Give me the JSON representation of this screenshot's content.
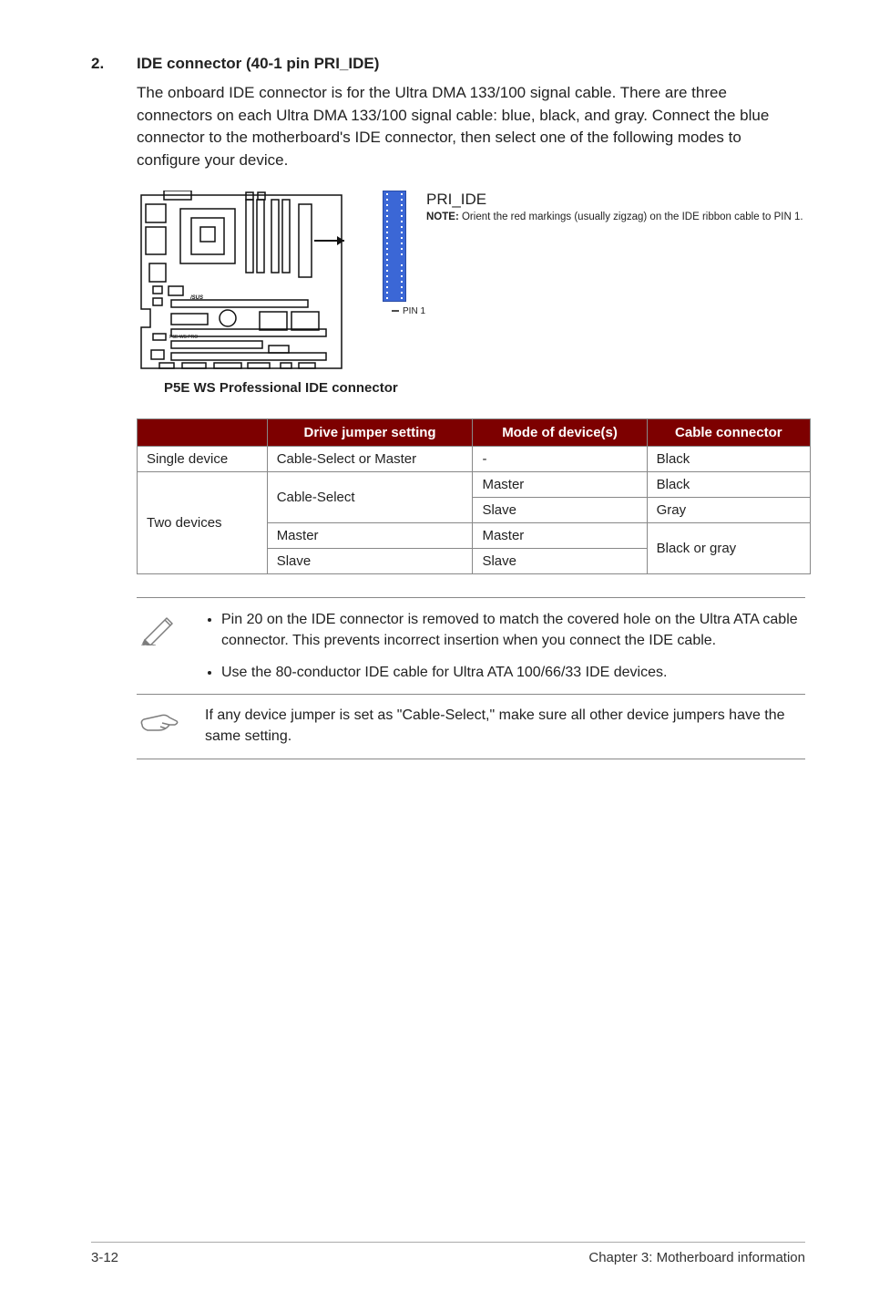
{
  "section": {
    "number": "2.",
    "title": "IDE connector (40-1 pin PRI_IDE)",
    "paragraph": "The onboard IDE connector is for the Ultra DMA 133/100 signal cable. There are three connectors on each Ultra DMA 133/100 signal cable: blue, black, and gray. Connect the blue connector to the motherboard's IDE connector, then select one of the following modes to configure your device."
  },
  "diagram": {
    "board_label": "P5E WS PRO",
    "connector_label": "PRI_IDE",
    "note_bold": "NOTE:",
    "note_text": "Orient the red markings (usually zigzag) on the IDE ribbon cable to PIN 1.",
    "pin1_label": "PIN 1",
    "caption": "P5E WS Professional IDE connector"
  },
  "table": {
    "headers": [
      "",
      "Drive jumper setting",
      "Mode of device(s)",
      "Cable connector"
    ],
    "rows": {
      "single_label": "Single device",
      "single_setting": "Cable-Select or Master",
      "single_mode": "-",
      "single_conn": "Black",
      "two_label": "Two devices",
      "two_cs_setting": "Cable-Select",
      "two_cs_master_mode": "Master",
      "two_cs_master_conn": "Black",
      "two_cs_slave_mode": "Slave",
      "two_cs_slave_conn": "Gray",
      "two_master_setting": "Master",
      "two_master_mode": "Master",
      "two_slave_setting": "Slave",
      "two_slave_mode": "Slave",
      "two_ms_conn": "Black or gray"
    }
  },
  "notes": {
    "bullet1": "Pin 20 on the IDE connector is removed to match the covered hole on the Ultra ATA cable connector. This prevents incorrect insertion when you connect the IDE cable.",
    "bullet2": "Use the 80-conductor IDE cable for Ultra ATA 100/66/33 IDE devices.",
    "hand_note": "If any device jumper is set as \"Cable-Select,\" make sure all other device jumpers have the same setting."
  },
  "footer": {
    "left": "3-12",
    "right": "Chapter 3:  Motherboard information"
  }
}
